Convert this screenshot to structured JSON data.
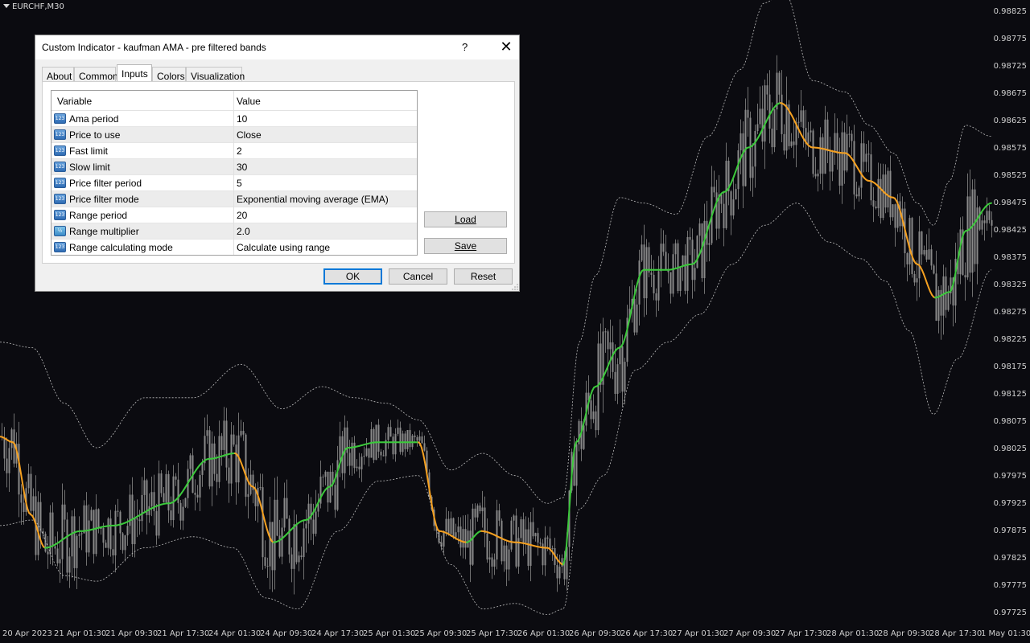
{
  "chart": {
    "symbol": "EURCHF,M30",
    "price_labels": [
      "0.98825",
      "0.98775",
      "0.98725",
      "0.98675",
      "0.98625",
      "0.98575",
      "0.98525",
      "0.98475",
      "0.98425",
      "0.98375",
      "0.98325",
      "0.98275",
      "0.98225",
      "0.98175",
      "0.98125",
      "0.98075",
      "0.98025",
      "0.97975",
      "0.97925",
      "0.97875",
      "0.97825",
      "0.97775",
      "0.97725"
    ],
    "time_labels": [
      "20 Apr 2023",
      "21 Apr 01:30",
      "21 Apr 09:30",
      "21 Apr 17:30",
      "24 Apr 01:30",
      "24 Apr 09:30",
      "24 Apr 17:30",
      "25 Apr 01:30",
      "25 Apr 09:30",
      "25 Apr 17:30",
      "26 Apr 01:30",
      "26 Apr 09:30",
      "26 Apr 17:30",
      "27 Apr 01:30",
      "27 Apr 09:30",
      "27 Apr 17:30",
      "28 Apr 01:30",
      "28 Apr 09:30",
      "28 Apr 17:30",
      "1 May 01:30"
    ],
    "colors": {
      "background": "#0b0b10",
      "candles": "#8a8a8a",
      "bands": "#bdbdbd",
      "ama_up": "#3cc83c",
      "ama_down": "#f5a020"
    }
  },
  "chart_data": {
    "type": "line",
    "ylim": [
      0.97725,
      0.98825
    ],
    "ama_anchors": [
      [
        0,
        0.9806
      ],
      [
        16,
        0.9805
      ],
      [
        38,
        0.9792
      ],
      [
        56,
        0.9786
      ],
      [
        100,
        0.9789
      ],
      [
        140,
        0.979
      ],
      [
        210,
        0.9794
      ],
      [
        260,
        0.9802
      ],
      [
        292,
        0.9803
      ],
      [
        314,
        0.9797
      ],
      [
        340,
        0.9787
      ],
      [
        380,
        0.9791
      ],
      [
        410,
        0.9797
      ],
      [
        432,
        0.9804
      ],
      [
        470,
        0.9805
      ],
      [
        520,
        0.9805
      ],
      [
        546,
        0.9789
      ],
      [
        580,
        0.9787
      ],
      [
        598,
        0.9789
      ],
      [
        640,
        0.9787
      ],
      [
        680,
        0.9786
      ],
      [
        700,
        0.9783
      ],
      [
        716,
        0.9805
      ],
      [
        740,
        0.9815
      ],
      [
        770,
        0.9822
      ],
      [
        800,
        0.9836
      ],
      [
        830,
        0.9836
      ],
      [
        860,
        0.9837
      ],
      [
        900,
        0.985
      ],
      [
        930,
        0.9858
      ],
      [
        970,
        0.9866
      ],
      [
        1010,
        0.9858
      ],
      [
        1050,
        0.9857
      ],
      [
        1080,
        0.9852
      ],
      [
        1110,
        0.9849
      ],
      [
        1140,
        0.9837
      ],
      [
        1162,
        0.9831
      ],
      [
        1180,
        0.9832
      ],
      [
        1200,
        0.9843
      ],
      [
        1232,
        0.9848
      ]
    ],
    "upper_band_anchors": [
      [
        0,
        0.9823
      ],
      [
        40,
        0.9822
      ],
      [
        80,
        0.9812
      ],
      [
        120,
        0.9804
      ],
      [
        180,
        0.9813
      ],
      [
        240,
        0.9813
      ],
      [
        300,
        0.9819
      ],
      [
        350,
        0.9811
      ],
      [
        400,
        0.9815
      ],
      [
        440,
        0.9813
      ],
      [
        480,
        0.9812
      ],
      [
        520,
        0.9809
      ],
      [
        560,
        0.98
      ],
      [
        600,
        0.9803
      ],
      [
        640,
        0.9799
      ],
      [
        680,
        0.9794
      ],
      [
        700,
        0.9795
      ],
      [
        720,
        0.9823
      ],
      [
        740,
        0.9835
      ],
      [
        770,
        0.9849
      ],
      [
        800,
        0.9848
      ],
      [
        840,
        0.9846
      ],
      [
        880,
        0.986
      ],
      [
        920,
        0.9872
      ],
      [
        950,
        0.9884
      ],
      [
        975,
        0.9886
      ],
      [
        1010,
        0.987
      ],
      [
        1050,
        0.9868
      ],
      [
        1080,
        0.9862
      ],
      [
        1110,
        0.9857
      ],
      [
        1140,
        0.9848
      ],
      [
        1160,
        0.9844
      ],
      [
        1180,
        0.9852
      ],
      [
        1200,
        0.9862
      ],
      [
        1232,
        0.986
      ]
    ],
    "lower_band_anchors": [
      [
        0,
        0.979
      ],
      [
        40,
        0.9791
      ],
      [
        80,
        0.9781
      ],
      [
        120,
        0.978
      ],
      [
        180,
        0.9786
      ],
      [
        240,
        0.9788
      ],
      [
        290,
        0.9786
      ],
      [
        330,
        0.9777
      ],
      [
        370,
        0.9775
      ],
      [
        420,
        0.9789
      ],
      [
        470,
        0.9798
      ],
      [
        520,
        0.9799
      ],
      [
        560,
        0.9783
      ],
      [
        600,
        0.9775
      ],
      [
        640,
        0.9776
      ],
      [
        680,
        0.9774
      ],
      [
        700,
        0.9775
      ],
      [
        720,
        0.9793
      ],
      [
        750,
        0.9799
      ],
      [
        790,
        0.9818
      ],
      [
        830,
        0.9823
      ],
      [
        870,
        0.9828
      ],
      [
        910,
        0.9837
      ],
      [
        950,
        0.9844
      ],
      [
        990,
        0.9848
      ],
      [
        1030,
        0.9841
      ],
      [
        1070,
        0.9838
      ],
      [
        1100,
        0.9834
      ],
      [
        1130,
        0.9825
      ],
      [
        1160,
        0.981
      ],
      [
        1190,
        0.982
      ],
      [
        1232,
        0.9836
      ]
    ]
  },
  "dialog": {
    "title": "Custom Indicator - kaufman AMA - pre filtered bands",
    "help": "?",
    "close": "✕",
    "tabs": [
      "About",
      "Common",
      "Inputs",
      "Colors",
      "Visualization"
    ],
    "active_tab": "Inputs",
    "columns": [
      "Variable",
      "Value"
    ],
    "rows": [
      {
        "icon": "123",
        "variable": "Ama period",
        "value": "10"
      },
      {
        "icon": "123",
        "variable": "Price to use",
        "value": "Close"
      },
      {
        "icon": "123",
        "variable": "Fast limit",
        "value": "2"
      },
      {
        "icon": "123",
        "variable": "Slow limit",
        "value": "30"
      },
      {
        "icon": "123",
        "variable": "Price filter period",
        "value": "5"
      },
      {
        "icon": "123",
        "variable": "Price filter mode",
        "value": "Exponential moving average (EMA)"
      },
      {
        "icon": "123",
        "variable": "Range period",
        "value": "20"
      },
      {
        "icon": "½",
        "variable": "Range multiplier",
        "value": "2.0"
      },
      {
        "icon": "123",
        "variable": "Range calculating mode",
        "value": "Calculate using range"
      }
    ],
    "load_label": "Load",
    "save_label": "Save",
    "ok_label": "OK",
    "cancel_label": "Cancel",
    "reset_label": "Reset"
  }
}
